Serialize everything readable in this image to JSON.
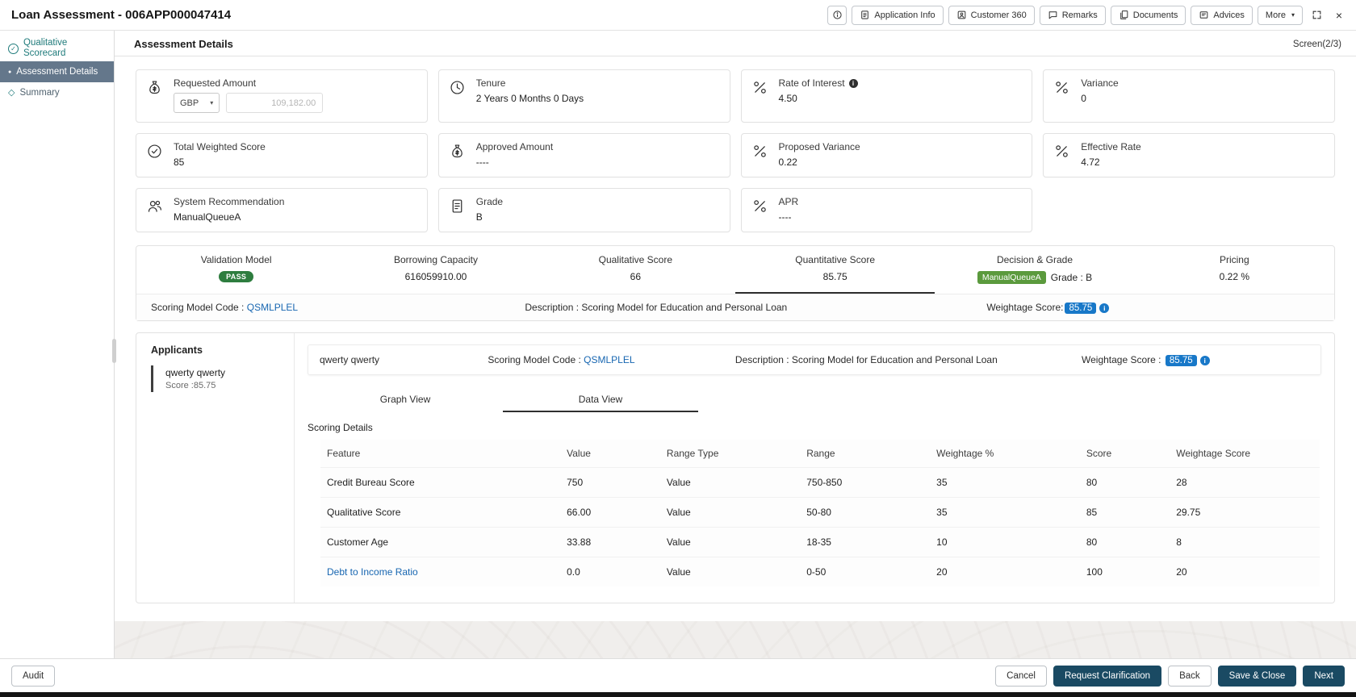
{
  "colors": {
    "primary_button": "#1a4a63",
    "sidebar_active_bg": "#64778b",
    "done_step_teal": "#1f7b7b",
    "pass_badge_green": "#2e7d3f",
    "decision_badge_green": "#5b9a3d",
    "weightage_badge_blue": "#1878c8",
    "link_blue": "#1766b1"
  },
  "header": {
    "title": "Loan Assessment - 006APP000047414",
    "actions": [
      {
        "label": "Application Info"
      },
      {
        "label": "Customer 360"
      },
      {
        "label": "Remarks"
      },
      {
        "label": "Documents"
      },
      {
        "label": "Advices"
      },
      {
        "label": "More"
      }
    ]
  },
  "sidebar": {
    "items": [
      {
        "label": "Qualitative Scorecard",
        "state": "done"
      },
      {
        "label": "Assessment Details",
        "state": "active"
      },
      {
        "label": "Summary",
        "state": "pending"
      }
    ]
  },
  "main": {
    "title": "Assessment Details",
    "screen_indicator": "Screen(2/3)"
  },
  "cards": [
    {
      "label": "Requested Amount",
      "currency": "GBP",
      "amount": "109,182.00"
    },
    {
      "label": "Tenure",
      "value": "2 Years 0 Months 0 Days"
    },
    {
      "label": "Rate of Interest",
      "value": "4.50"
    },
    {
      "label": "Variance",
      "value": "0"
    },
    {
      "label": "Total Weighted Score",
      "value": "85"
    },
    {
      "label": "Approved Amount",
      "value": "----"
    },
    {
      "label": "Proposed Variance",
      "value": "0.22"
    },
    {
      "label": "Effective Rate",
      "value": "4.72"
    },
    {
      "label": "System Recommendation",
      "value": "ManualQueueA"
    },
    {
      "label": "Grade",
      "value": "B"
    },
    {
      "label": "APR",
      "value": "----"
    }
  ],
  "summary_strip": {
    "items": [
      {
        "label": "Validation Model",
        "value": "PASS"
      },
      {
        "label": "Borrowing Capacity",
        "value": "616059910.00"
      },
      {
        "label": "Qualitative Score",
        "value": "66"
      },
      {
        "label": "Quantitative Score",
        "value": "85.75"
      },
      {
        "label": "Decision & Grade",
        "value": "ManualQueueA",
        "extra": "Grade : B"
      },
      {
        "label": "Pricing",
        "value": "0.22 %"
      }
    ],
    "model_row": {
      "code_label": "Scoring Model Code : ",
      "code": "QSMLPLEL",
      "description": "Description : Scoring Model for Education and Personal Loan",
      "weightage_label": "Weightage Score:",
      "weightage": "85.75"
    }
  },
  "applicants": {
    "title": "Applicants",
    "selected": {
      "name": "qwerty qwerty",
      "score": "Score :85.75"
    },
    "detail": {
      "name": "qwerty qwerty",
      "code_label": "Scoring Model Code : ",
      "code": "QSMLPLEL",
      "description": "Description : Scoring Model for Education and Personal Loan",
      "weightage_label": "Weightage Score : ",
      "weightage": "85.75"
    },
    "tabs": [
      {
        "label": "Graph View"
      },
      {
        "label": "Data View"
      }
    ]
  },
  "scoring_table": {
    "title": "Scoring Details",
    "headers": [
      "Feature",
      "Value",
      "Range Type",
      "Range",
      "Weightage %",
      "Score",
      "Weightage Score"
    ],
    "rows": [
      {
        "feature": "Credit Bureau Score",
        "value": "750",
        "range_type": "Value",
        "range": "750-850",
        "weightage_pct": "35",
        "score": "80",
        "weightage_score": "28"
      },
      {
        "feature": "Qualitative Score",
        "value": "66.00",
        "range_type": "Value",
        "range": "50-80",
        "weightage_pct": "35",
        "score": "85",
        "weightage_score": "29.75"
      },
      {
        "feature": "Customer Age",
        "value": "33.88",
        "range_type": "Value",
        "range": "18-35",
        "weightage_pct": "10",
        "score": "80",
        "weightage_score": "8"
      },
      {
        "feature": "Debt to Income Ratio",
        "value": "0.0",
        "range_type": "Value",
        "range": "0-50",
        "weightage_pct": "20",
        "score": "100",
        "weightage_score": "20"
      }
    ]
  },
  "footer": {
    "audit": "Audit",
    "buttons": [
      {
        "label": "Cancel"
      },
      {
        "label": "Request Clarification"
      },
      {
        "label": "Back"
      },
      {
        "label": "Save & Close"
      },
      {
        "label": "Next"
      }
    ]
  }
}
